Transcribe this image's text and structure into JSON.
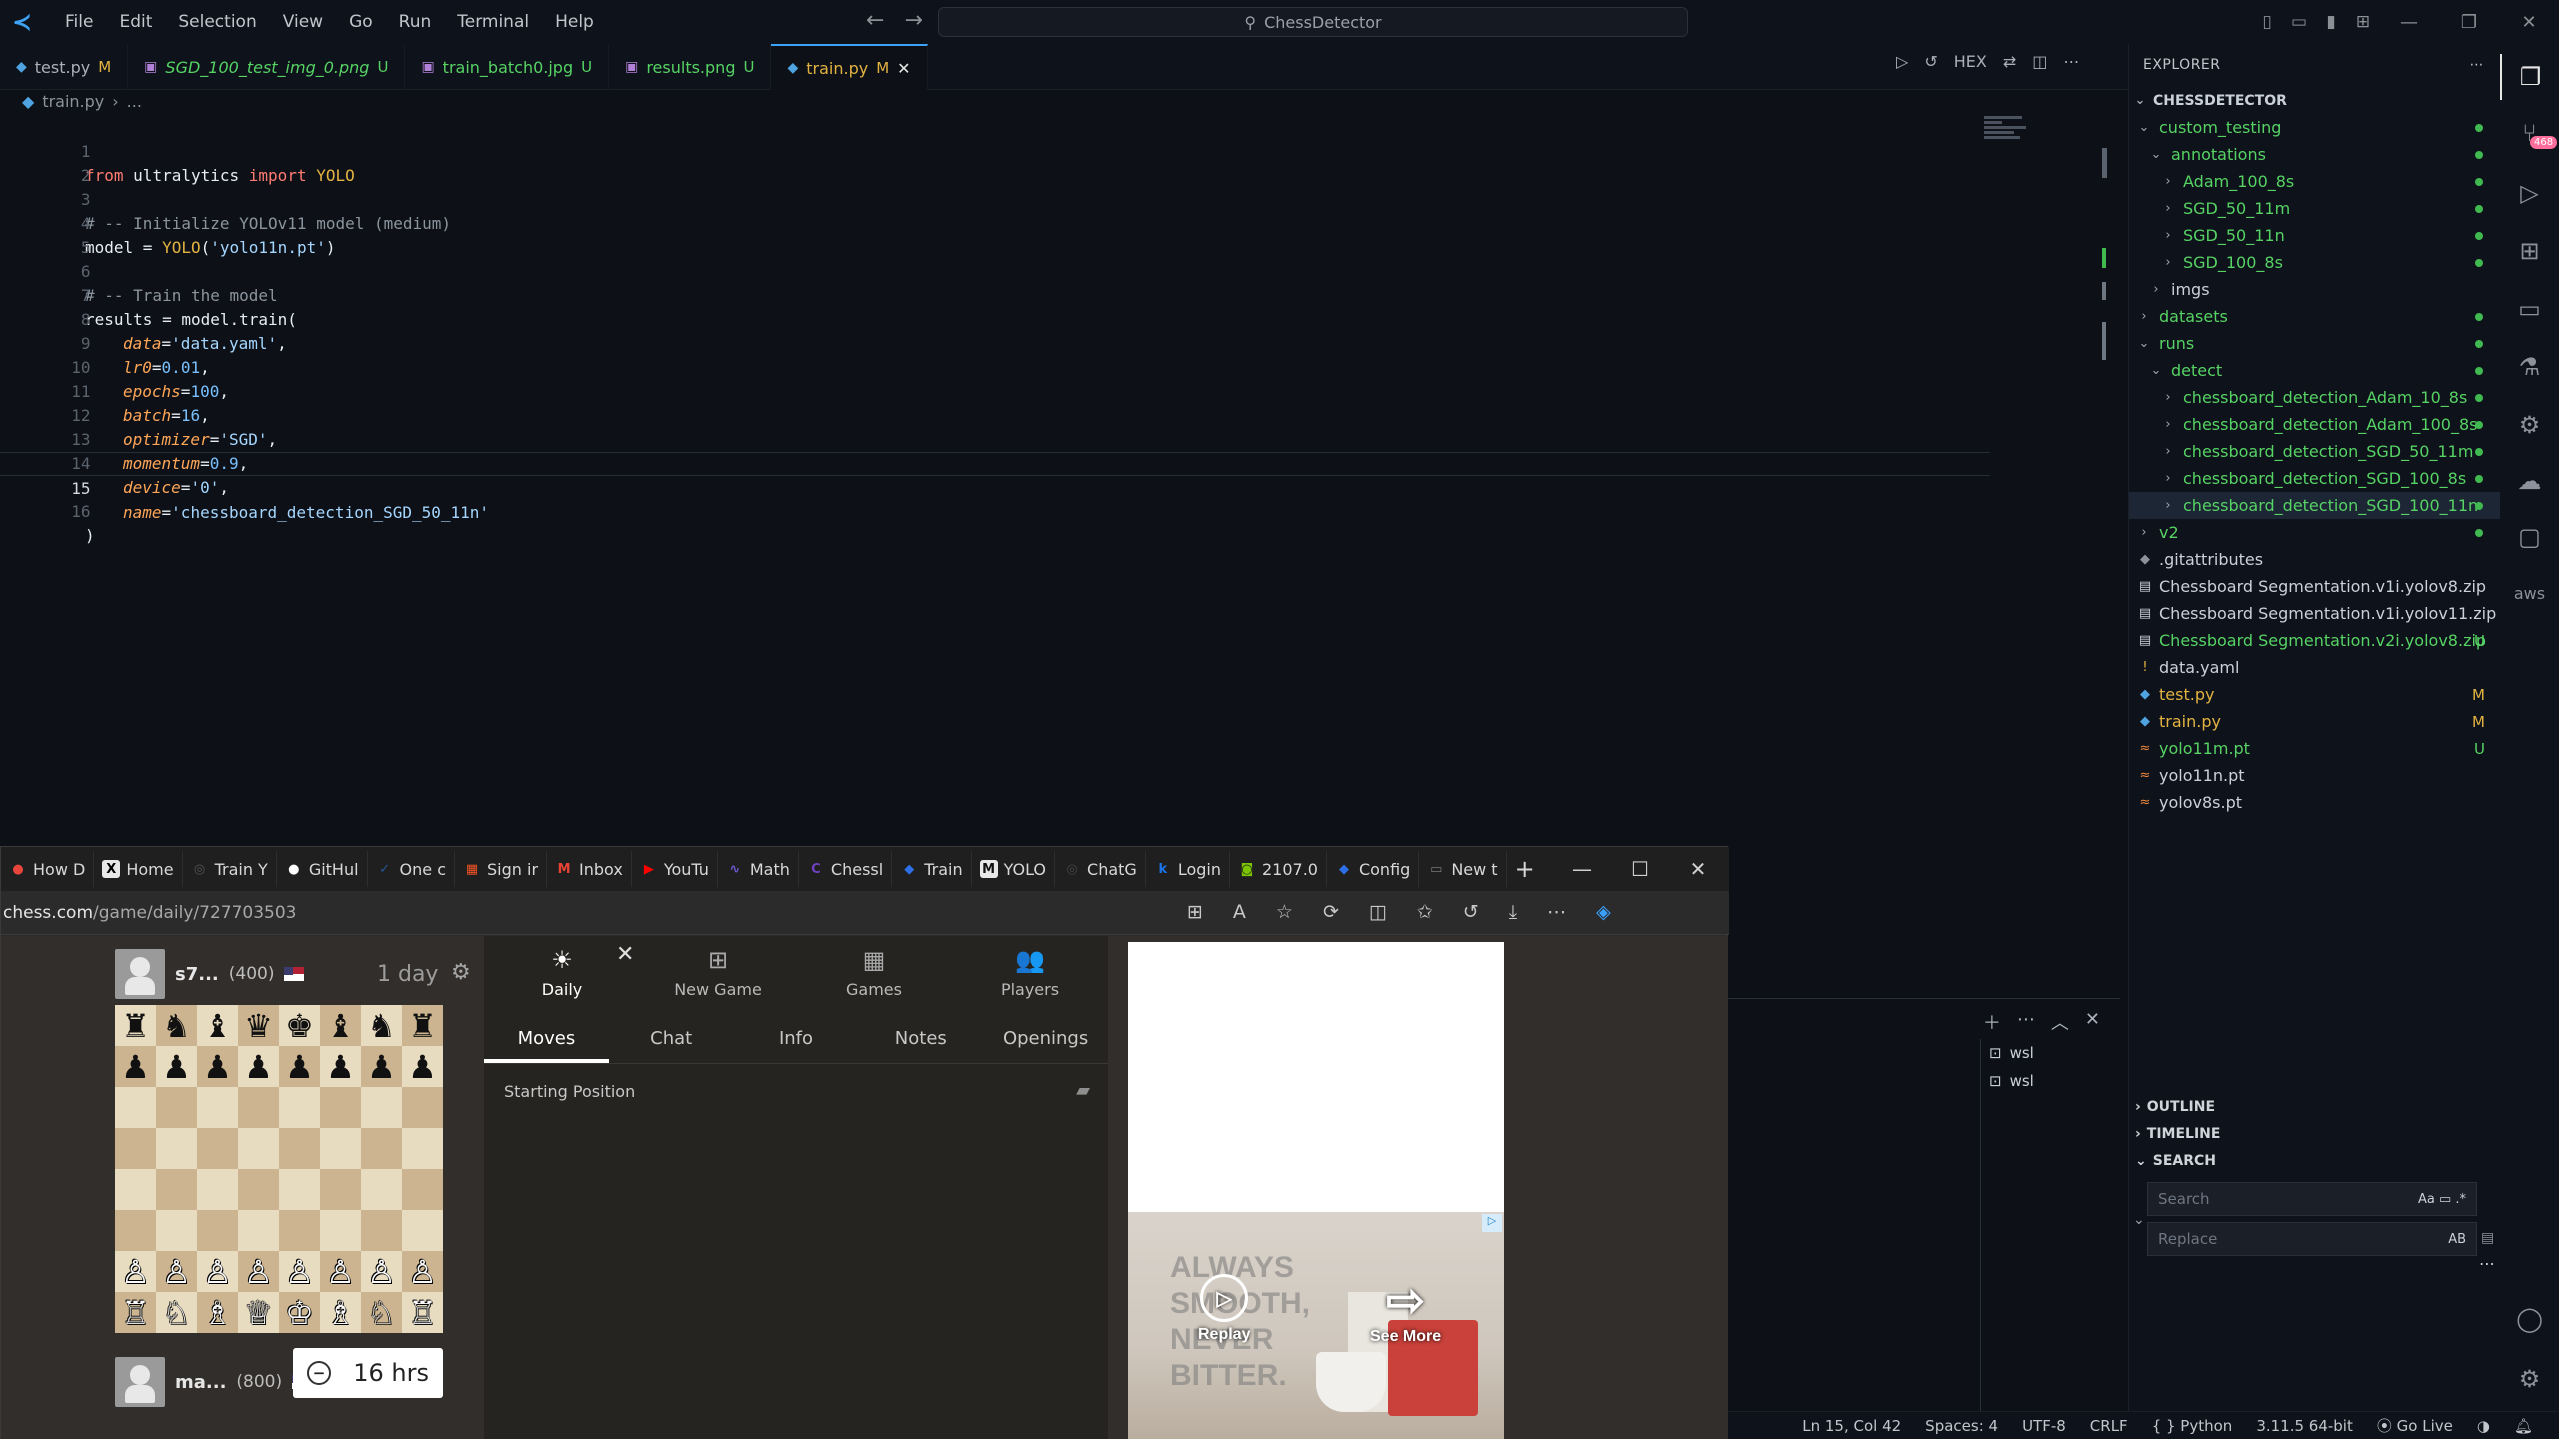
{
  "titlebar": {
    "menu": [
      "File",
      "Edit",
      "Selection",
      "View",
      "Go",
      "Run",
      "Terminal",
      "Help"
    ],
    "search": "ChessDetector"
  },
  "tabs": [
    {
      "label": "test.py",
      "status": "M",
      "type": "py"
    },
    {
      "label": "SGD_100_test_img_0.png",
      "status": "U",
      "type": "img"
    },
    {
      "label": "train_batch0.jpg",
      "status": "U",
      "type": "img"
    },
    {
      "label": "results.png",
      "status": "U",
      "type": "img"
    },
    {
      "label": "train.py",
      "status": "M",
      "type": "py",
      "active": true
    }
  ],
  "editor_actions": {
    "hex": "HEX"
  },
  "breadcrumb": {
    "file": "train.py",
    "rest": "..."
  },
  "code": {
    "line_numbers": [
      "1",
      "2",
      "3",
      "4",
      "5",
      "6",
      "7",
      "8",
      "9",
      "10",
      "11",
      "12",
      "13",
      "14",
      "15",
      "16"
    ],
    "current_line": 15,
    "l1": {
      "kw": "from",
      "mod": "ultralytics",
      "kw2": "import",
      "cls": "YOLO"
    },
    "l3": "# -- Initialize YOLOv11 model (medium)",
    "l4": {
      "var": "model",
      "eq": " = ",
      "cls": "YOLO",
      "open": "(",
      "str": "'yolo11n.pt'",
      "close": ")"
    },
    "l6": "# -- Train the model",
    "l7": {
      "var": "results",
      "eq": " = ",
      "call": "model.train("
    },
    "l8": {
      "p": "data",
      "v": "'data.yaml'"
    },
    "l9": {
      "p": "lr0",
      "v": "0.01"
    },
    "l10": {
      "p": "epochs",
      "v": "100"
    },
    "l11": {
      "p": "batch",
      "v": "16"
    },
    "l12": {
      "p": "optimizer",
      "v": "'SGD'"
    },
    "l13": {
      "p": "momentum",
      "v": "0.9"
    },
    "l14": {
      "p": "device",
      "v": "'0'"
    },
    "l15": {
      "p": "name",
      "v": "'chessboard_detection_SGD_50_11n'"
    },
    "l16": ")"
  },
  "explorer": {
    "title": "EXPLORER",
    "project": "CHESSDETECTOR",
    "items": [
      {
        "label": "custom_testing",
        "depth": 1,
        "kind": "folder-open",
        "color": "green",
        "dot": true
      },
      {
        "label": "annotations",
        "depth": 2,
        "kind": "folder-open",
        "color": "green",
        "dot": true
      },
      {
        "label": "Adam_100_8s",
        "depth": 3,
        "kind": "folder",
        "color": "green",
        "dot": true
      },
      {
        "label": "SGD_50_11m",
        "depth": 3,
        "kind": "folder",
        "color": "green",
        "dot": true
      },
      {
        "label": "SGD_50_11n",
        "depth": 3,
        "kind": "folder",
        "color": "green",
        "dot": true
      },
      {
        "label": "SGD_100_8s",
        "depth": 3,
        "kind": "folder",
        "color": "green",
        "dot": true
      },
      {
        "label": "imgs",
        "depth": 2,
        "kind": "folder",
        "color": "white",
        "dot": false
      },
      {
        "label": "datasets",
        "depth": 1,
        "kind": "folder",
        "color": "green",
        "dot": true
      },
      {
        "label": "runs",
        "depth": 1,
        "kind": "folder-open",
        "color": "green",
        "dot": true
      },
      {
        "label": "detect",
        "depth": 2,
        "kind": "folder-open",
        "color": "green",
        "dot": true
      },
      {
        "label": "chessboard_detection_Adam_10_8s",
        "depth": 3,
        "kind": "folder",
        "color": "green",
        "dot": true
      },
      {
        "label": "chessboard_detection_Adam_100_8s",
        "depth": 3,
        "kind": "folder",
        "color": "green",
        "dot": true
      },
      {
        "label": "chessboard_detection_SGD_50_11m",
        "depth": 3,
        "kind": "folder",
        "color": "green",
        "dot": true
      },
      {
        "label": "chessboard_detection_SGD_100_8s",
        "depth": 3,
        "kind": "folder",
        "color": "green",
        "dot": true
      },
      {
        "label": "chessboard_detection_SGD_100_11n",
        "depth": 3,
        "kind": "folder",
        "color": "green",
        "dot": true,
        "selected": true
      },
      {
        "label": "v2",
        "depth": 1,
        "kind": "folder",
        "color": "green",
        "dot": true
      },
      {
        "label": ".gitattributes",
        "depth": 1,
        "kind": "git",
        "color": "white"
      },
      {
        "label": "Chessboard Segmentation.v1i.yolov8.zip",
        "depth": 1,
        "kind": "zip",
        "color": "white"
      },
      {
        "label": "Chessboard Segmentation.v1i.yolov11.zip",
        "depth": 1,
        "kind": "zip",
        "color": "white"
      },
      {
        "label": "Chessboard Segmentation.v2i.yolov8.zip",
        "depth": 1,
        "kind": "zip",
        "color": "green",
        "status": "U"
      },
      {
        "label": "data.yaml",
        "depth": 1,
        "kind": "yaml",
        "color": "white"
      },
      {
        "label": "test.py",
        "depth": 1,
        "kind": "py",
        "color": "orange",
        "status": "M"
      },
      {
        "label": "train.py",
        "depth": 1,
        "kind": "py",
        "color": "orange",
        "status": "M"
      },
      {
        "label": "yolo11m.pt",
        "depth": 1,
        "kind": "pt",
        "color": "green",
        "status": "U"
      },
      {
        "label": "yolo11n.pt",
        "depth": 1,
        "kind": "pt",
        "color": "white"
      },
      {
        "label": "yolov8s.pt",
        "depth": 1,
        "kind": "pt",
        "color": "white"
      }
    ],
    "sections": {
      "outline": "OUTLINE",
      "timeline": "TIMELINE",
      "search": "SEARCH"
    },
    "search_placeholder": "Search",
    "replace_placeholder": "Replace",
    "search_opts": "Aa",
    "replace_opts": "AB"
  },
  "activity": {
    "source_control_badge": "468"
  },
  "terminal": {
    "items": [
      "wsl",
      "wsl"
    ]
  },
  "statusbar": {
    "items": [
      "Ln 15, Col 42",
      "Spaces: 4",
      "UTF-8",
      "CRLF",
      "{ } Python",
      "3.11.5 64-bit",
      "Go Live"
    ]
  },
  "browser": {
    "tabs": [
      {
        "label": "How D",
        "fav": "●",
        "color": "#e8453c"
      },
      {
        "label": "Home",
        "fav": "X",
        "color": "#000000"
      },
      {
        "label": "Train Y",
        "fav": "◎",
        "color": "#555555"
      },
      {
        "label": "GitHul",
        "fav": "●",
        "color": "#ffffff"
      },
      {
        "label": "One c",
        "fav": "✓",
        "color": "#2b5797"
      },
      {
        "label": "Sign ir",
        "fav": "▦",
        "color": "#f35325"
      },
      {
        "label": "Inbox",
        "fav": "M",
        "color": "#ea4335"
      },
      {
        "label": "YouTu",
        "fav": "▶",
        "color": "#ff0000"
      },
      {
        "label": "Math",
        "fav": "∿",
        "color": "#6a5acd"
      },
      {
        "label": "Chessl",
        "fav": "C",
        "color": "#6f42c1"
      },
      {
        "label": "Train",
        "fav": "◆",
        "color": "#2e6ee6"
      },
      {
        "label": "YOLO",
        "fav": "M",
        "color": "#111111"
      },
      {
        "label": "ChatG",
        "fav": "◎",
        "color": "#444444"
      },
      {
        "label": "Login",
        "fav": "k",
        "color": "#1a73e8"
      },
      {
        "label": "2107.0",
        "fav": "◙",
        "color": "#7cc300"
      },
      {
        "label": "Config",
        "fav": "◆",
        "color": "#2e6ee6"
      },
      {
        "label": "New t",
        "fav": "▭",
        "color": "#777777"
      }
    ],
    "url_host": "chess.com",
    "url_path": "/game/daily/727703503",
    "player_top": {
      "name": "s7...",
      "rating": "(400)",
      "clock": "1 day"
    },
    "player_bottom": {
      "name": "ma...",
      "rating": "(800)",
      "clock": "16 hrs"
    },
    "nav": [
      {
        "label": "Daily",
        "icon": "☀",
        "active": true
      },
      {
        "label": "New Game",
        "icon": "⊞"
      },
      {
        "label": "Games",
        "icon": "▦"
      },
      {
        "label": "Players",
        "icon": "👥"
      }
    ],
    "subtabs": [
      {
        "label": "Moves",
        "active": true
      },
      {
        "label": "Chat"
      },
      {
        "label": "Info"
      },
      {
        "label": "Notes"
      },
      {
        "label": "Openings"
      }
    ],
    "starting_position": "Starting Position",
    "ad": {
      "headline": "ALWAYS\nSMOOTH,\nNEVER\nBITTER.",
      "replay": "Replay",
      "see_more": "See More"
    },
    "board": [
      [
        "♜",
        "♞",
        "♝",
        "♛",
        "♚",
        "♝",
        "♞",
        "♜"
      ],
      [
        "♟",
        "♟",
        "♟",
        "♟",
        "♟",
        "♟",
        "♟",
        "♟"
      ],
      [
        "",
        "",
        "",
        "",
        "",
        "",
        "",
        ""
      ],
      [
        "",
        "",
        "",
        "",
        "",
        "",
        "",
        ""
      ],
      [
        "",
        "",
        "",
        "",
        "",
        "",
        "",
        ""
      ],
      [
        "",
        "",
        "",
        "",
        "",
        "",
        "",
        ""
      ],
      [
        "♙",
        "♙",
        "♙",
        "♙",
        "♙",
        "♙",
        "♙",
        "♙"
      ],
      [
        "♖",
        "♘",
        "♗",
        "♕",
        "♔",
        "♗",
        "♘",
        "♖"
      ]
    ]
  }
}
